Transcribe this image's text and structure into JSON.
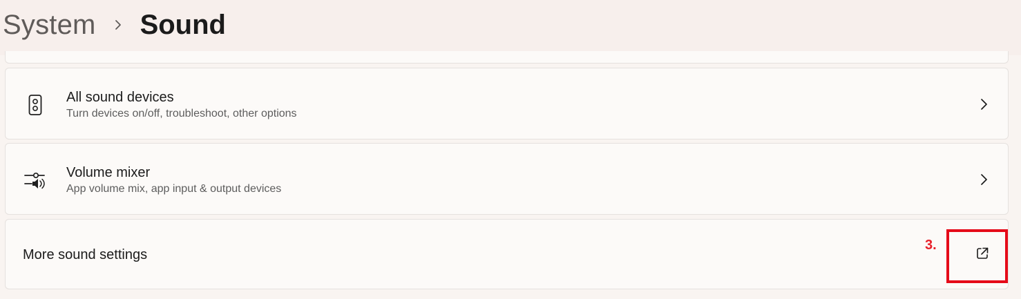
{
  "breadcrumb": {
    "parent": "System",
    "separator_icon": "chevron-right-icon",
    "current": "Sound"
  },
  "settings": {
    "all_sound_devices": {
      "icon": "speaker-device-icon",
      "title": "All sound devices",
      "description": "Turn devices on/off, troubleshoot, other options",
      "action_icon": "chevron-right-icon"
    },
    "volume_mixer": {
      "icon": "volume-mixer-icon",
      "title": "Volume mixer",
      "description": "App volume mix, app input & output devices",
      "action_icon": "chevron-right-icon"
    },
    "more_sound_settings": {
      "title": "More sound settings",
      "action_icon": "open-external-icon"
    }
  },
  "annotation": {
    "label": "3.",
    "color": "#e50b19"
  }
}
